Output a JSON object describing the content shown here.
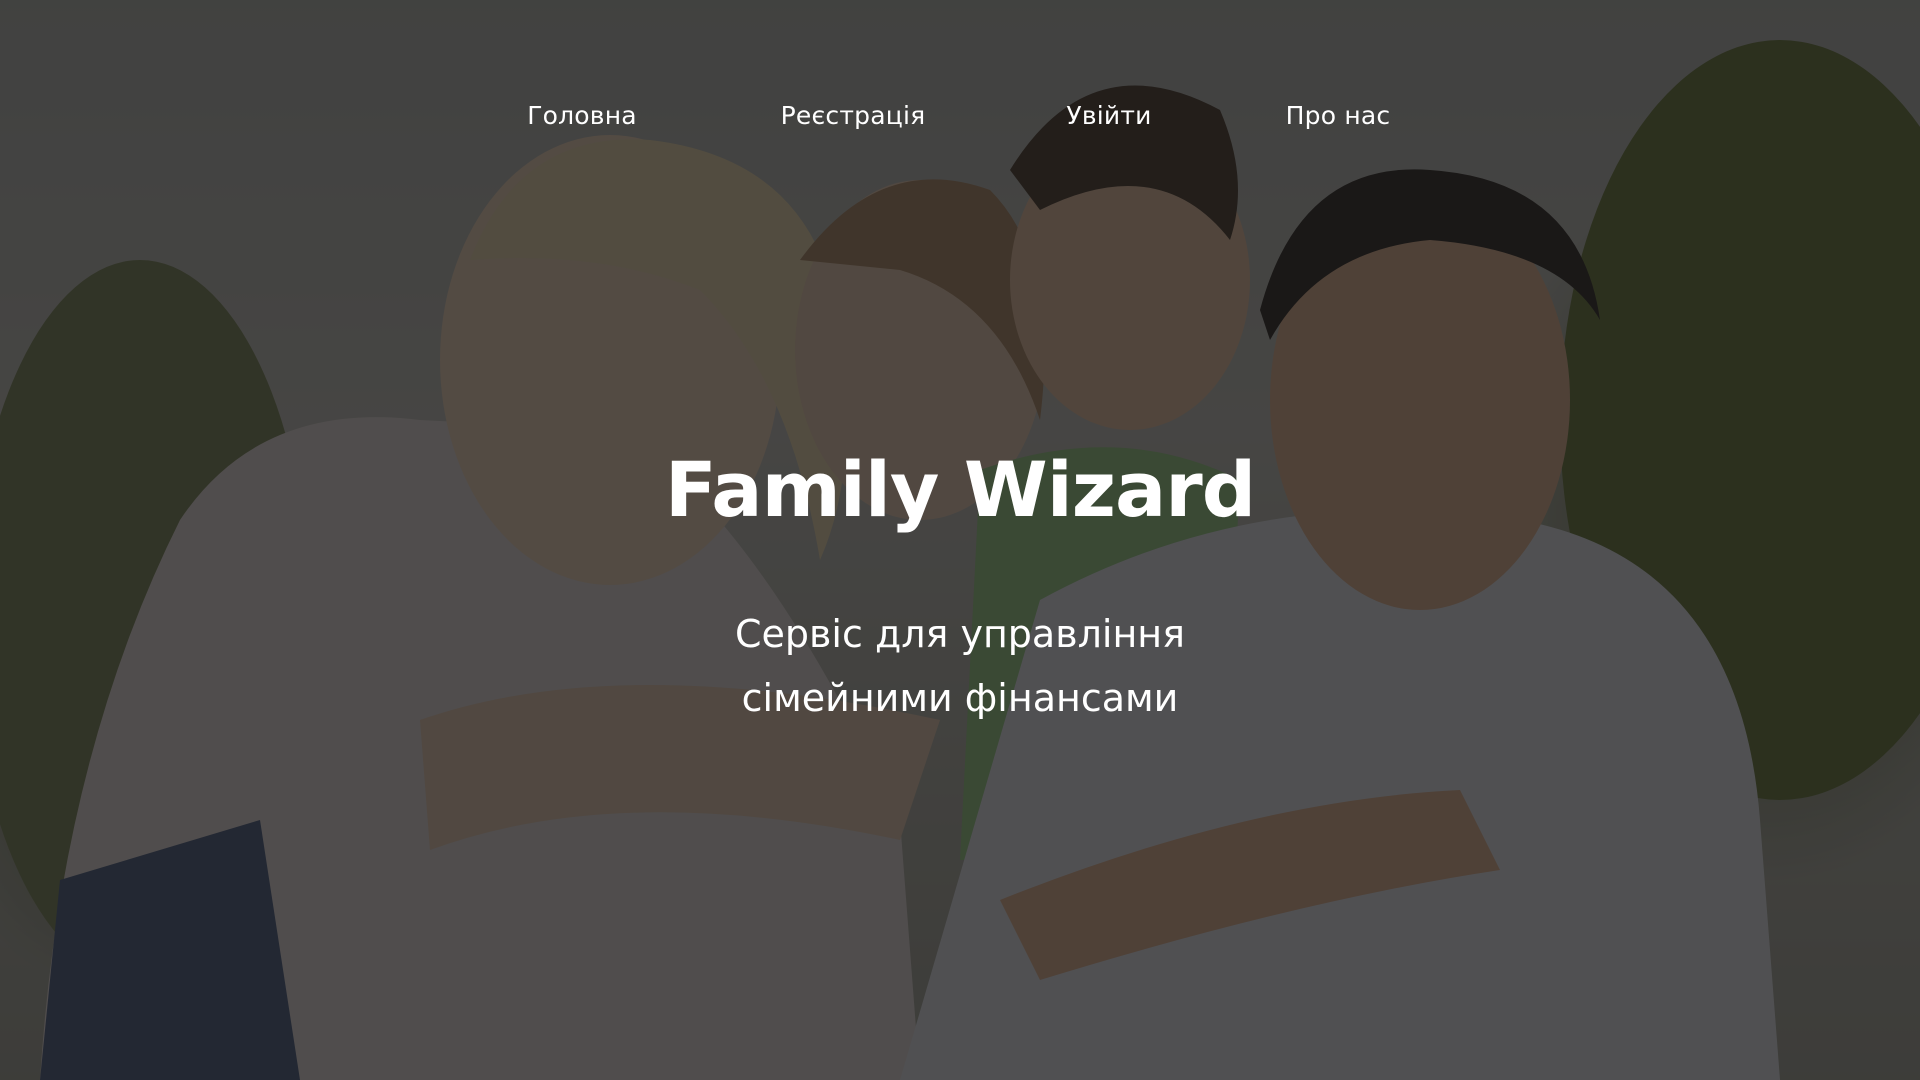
{
  "nav": {
    "items": [
      {
        "label": "Головна"
      },
      {
        "label": "Реєстрація"
      },
      {
        "label": "Увійти"
      },
      {
        "label": "Про нас"
      }
    ]
  },
  "hero": {
    "title": "Family Wizard",
    "subtitle_line1": "Сервіс для управління",
    "subtitle_line2": "сімейними фінансами",
    "background_image": "family-photo",
    "overlay_color": "#141414"
  }
}
